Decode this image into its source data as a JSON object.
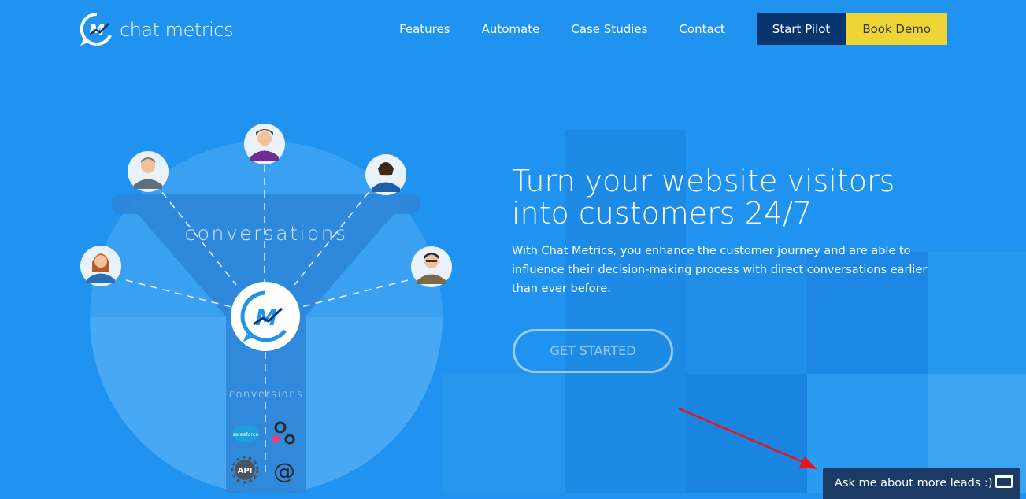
{
  "brand": {
    "name": "chat metrics"
  },
  "nav": {
    "links": [
      "Features",
      "Automate",
      "Case Studies",
      "Contact"
    ],
    "start_pilot": "Start Pilot",
    "book_demo": "Book Demo"
  },
  "hero": {
    "title_line1": "Turn your website visitors",
    "title_line2": "into customers 24/7",
    "description": "With Chat Metrics, you enhance the customer journey and are able to influence their decision-making process with direct conversations earlier than ever before.",
    "cta": "GET STARTED"
  },
  "illustration": {
    "top_label": "conversations",
    "bottom_label": "conversions",
    "integrations": [
      "salesforce",
      "API",
      "@"
    ]
  },
  "chat_widget": {
    "label": "Ask me about more leads :)"
  },
  "colors": {
    "background": "#1f93ef",
    "start_pilot_bg": "#08356e",
    "book_demo_bg": "#ecd534",
    "chat_widget_bg": "#1b3a66",
    "annotation_arrow": "#e8141a"
  }
}
